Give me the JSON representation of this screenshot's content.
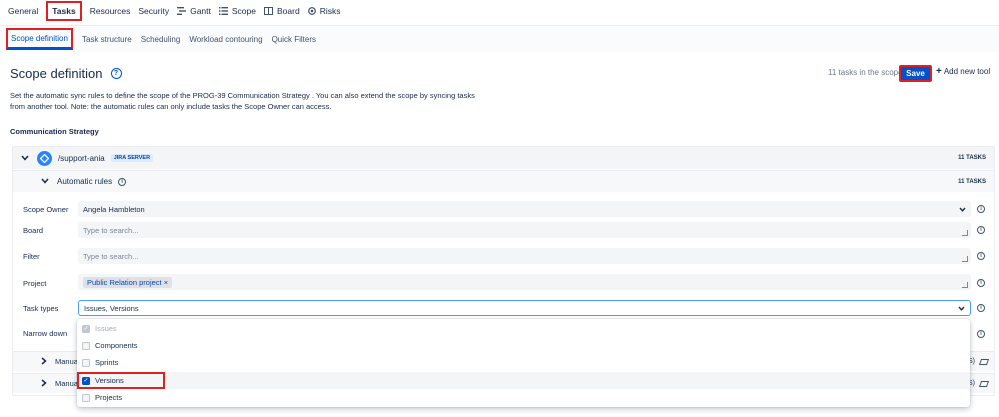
{
  "top_nav": {
    "items": [
      {
        "label": "General",
        "icon": ""
      },
      {
        "label": "Tasks",
        "icon": ""
      },
      {
        "label": "Resources",
        "icon": ""
      },
      {
        "label": "Security",
        "icon": ""
      },
      {
        "label": "Gantt",
        "icon": "gantt-icon"
      },
      {
        "label": "Scope",
        "icon": "list-icon"
      },
      {
        "label": "Board",
        "icon": "board-icon"
      },
      {
        "label": "Risks",
        "icon": "risk-icon"
      }
    ],
    "active": "Tasks"
  },
  "sub_nav": {
    "tabs": [
      "Scope definition",
      "Task structure",
      "Scheduling",
      "Workload contouring",
      "Quick Filters"
    ],
    "active": "Scope definition"
  },
  "header": {
    "title": "Scope definition",
    "help_glyph": "?",
    "task_count_label": "11 tasks in the scope",
    "save_label": "Save",
    "add_tool_label": "Add new tool"
  },
  "description": "Set the automatic sync rules to define the scope of the PROG-39 Communication Strategy . You can also extend the scope by syncing tasks from another tool. Note: the automatic rules can only include tasks the Scope Owner can access.",
  "section_heading": "Communication Strategy",
  "source": {
    "name": "/support-ania",
    "badge": "JIRA SERVER",
    "count": "11 TASKS",
    "rules": {
      "label": "Automatic rules",
      "count": "11 TASKS"
    }
  },
  "form": {
    "scope_owner": {
      "label": "Scope Owner",
      "value": "Angela Hambleton"
    },
    "board": {
      "label": "Board",
      "placeholder": "Type to search..."
    },
    "filter": {
      "label": "Filter",
      "placeholder": "Type to search..."
    },
    "project": {
      "label": "Project",
      "chip": "Public Relation project",
      "chip_remove": "×"
    },
    "task_types": {
      "label": "Task types",
      "value": "Issues, Versions"
    },
    "narrow_down": {
      "label": "Narrow down"
    }
  },
  "collapsed_rows": [
    {
      "label": "Manua",
      "tail": "S)"
    },
    {
      "label": "Manua",
      "tail": "S)"
    }
  ],
  "dropdown": {
    "options": [
      {
        "label": "Issues",
        "state": "checked-disabled"
      },
      {
        "label": "Components",
        "state": "unchecked"
      },
      {
        "label": "Sprints",
        "state": "unchecked"
      },
      {
        "label": "Versions",
        "state": "checked"
      },
      {
        "label": "Projects",
        "state": "unchecked"
      }
    ]
  },
  "colors": {
    "primary": "#0052cc",
    "annotation_red": "#e02020",
    "field_bg": "#f4f5f7",
    "jira_blue": "#2684ff"
  }
}
